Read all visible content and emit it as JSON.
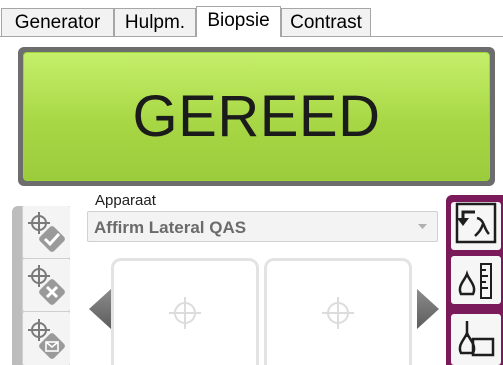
{
  "tabs": [
    {
      "label": "Generator",
      "active": false
    },
    {
      "label": "Hulpm.",
      "active": false
    },
    {
      "label": "Biopsie",
      "active": true
    },
    {
      "label": "Contrast",
      "active": false
    }
  ],
  "status": {
    "text": "GEREED",
    "color": "#a7d744"
  },
  "device": {
    "label": "Apparaat",
    "selected": "Affirm Lateral QAS"
  },
  "left_tools": [
    {
      "icon": "target-accept-icon"
    },
    {
      "icon": "target-delete-icon"
    },
    {
      "icon": "target-send-icon"
    }
  ],
  "right_tools": [
    {
      "icon": "exchange-view-icon"
    },
    {
      "icon": "needle-length-icon"
    },
    {
      "icon": "biopsy-device-icon"
    }
  ],
  "targets": [
    {
      "icon": "crosshair-icon"
    },
    {
      "icon": "crosshair-icon"
    }
  ],
  "colors": {
    "accent": "#7a1a5a",
    "ready": "#a7d744"
  }
}
